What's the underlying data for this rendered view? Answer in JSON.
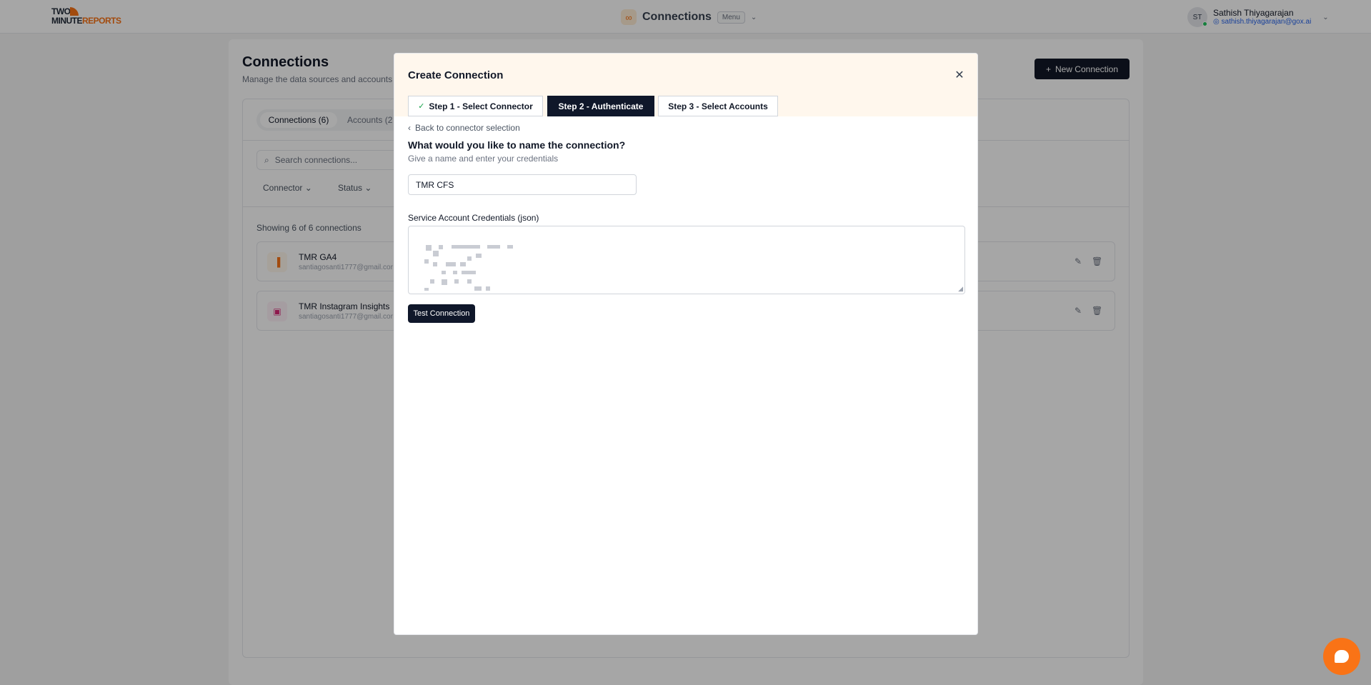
{
  "topnav": {
    "logo_line1": "TWO",
    "logo_line2a": "MINUTE",
    "logo_line2b": "REPORTS",
    "title": "Connections",
    "menu_label": "Menu",
    "user_initials": "ST",
    "user_name": "Sathish Thiyagarajan",
    "user_email": "sathish.thiyagarajan@gox.ai"
  },
  "background_page": {
    "title": "Connections",
    "subtitle": "Manage the data sources and accounts p",
    "new_connection_label": "New Connection",
    "tabs": [
      {
        "label": "Connections (6)"
      },
      {
        "label": "Accounts (2"
      }
    ],
    "search_placeholder": "Search connections...",
    "filters": [
      {
        "label": "Connector"
      },
      {
        "label": "Status"
      }
    ],
    "showing_text": "Showing 6 of 6 connections",
    "rows": [
      {
        "name": "TMR GA4",
        "email": "santiagosanti1777@gmail.cor"
      },
      {
        "name": "TMR Instagram Insights",
        "email": "santiagosanti1777@gmail.cor"
      }
    ]
  },
  "modal": {
    "title": "Create Connection",
    "steps": [
      {
        "label": "Step 1 - Select Connector",
        "state": "done"
      },
      {
        "label": "Step 2 - Authenticate",
        "state": "active"
      },
      {
        "label": "Step 3 - Select Accounts",
        "state": "pending"
      }
    ],
    "back_label": "Back to connector selection",
    "question": "What would you like to name the connection?",
    "hint": "Give a name and enter your credentials",
    "name_value": "TMR CFS",
    "credentials_label": "Service Account Credentials (json)",
    "test_button_label": "Test Connection"
  },
  "colors": {
    "brand_orange": "#f97316",
    "dark": "#0f172a",
    "modal_header_bg": "#fff7ed",
    "success": "#16a34a"
  },
  "icons": {
    "nav_connections": "link-icon",
    "close": "close-icon",
    "check": "check-icon",
    "back": "chevron-left-icon",
    "chat": "chat-bubble-icon"
  }
}
